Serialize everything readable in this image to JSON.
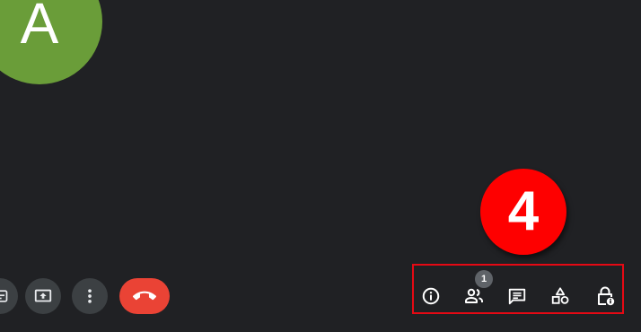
{
  "participant": {
    "avatar_initial": "A",
    "avatar_color": "#6a9d39"
  },
  "controls": {
    "items": [
      {
        "icon": "captions-icon"
      },
      {
        "icon": "present-screen-icon"
      },
      {
        "icon": "more-options-icon"
      },
      {
        "icon": "leave-call-icon"
      }
    ],
    "leave_color": "#ea4335"
  },
  "tutorial": {
    "step_number": "4",
    "badge_color": "#fe0000",
    "highlight_color": "#e50914"
  },
  "toolbar": {
    "items": [
      {
        "icon": "info-icon"
      },
      {
        "icon": "people-icon",
        "badge_count": "1"
      },
      {
        "icon": "chat-icon"
      },
      {
        "icon": "activities-icon"
      },
      {
        "icon": "host-controls-icon"
      }
    ]
  }
}
